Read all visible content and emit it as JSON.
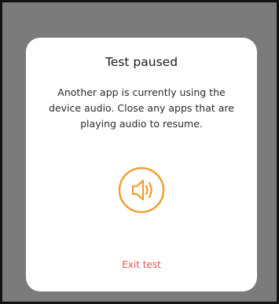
{
  "dialog": {
    "title": "Test paused",
    "message": "Another app is currently using the device audio. Close any apps that are playing audio to resume.",
    "icon": "speaker-icon",
    "exit_label": "Exit test"
  },
  "colors": {
    "backdrop": "#7b7b7b",
    "accent": "#f0a030",
    "exit": "#e8534c"
  }
}
